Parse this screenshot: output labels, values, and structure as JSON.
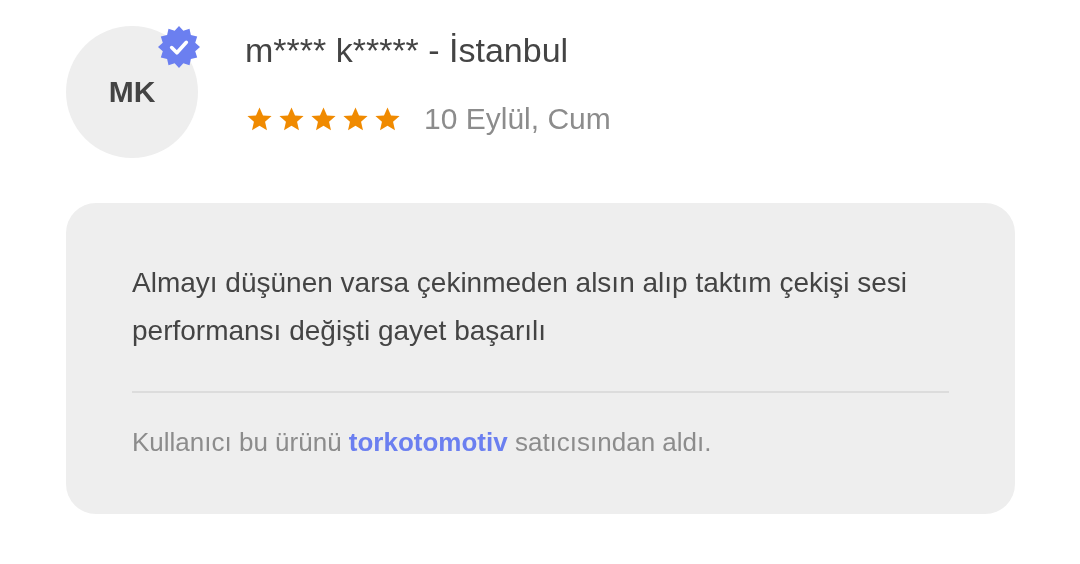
{
  "review": {
    "avatar_initials": "MK",
    "verified": true,
    "author": "m**** k***** - İstanbul",
    "stars": 5,
    "date": "10 Eylül, Cum",
    "comment": "Almayı düşünen varsa çekinmeden alsın alıp taktım çekişi sesi performansı değişti gayet başarılı",
    "seller_note": {
      "before": "Kullanıcı bu ürünü ",
      "seller": "torkotomotiv",
      "after": " satıcısından aldı."
    }
  }
}
